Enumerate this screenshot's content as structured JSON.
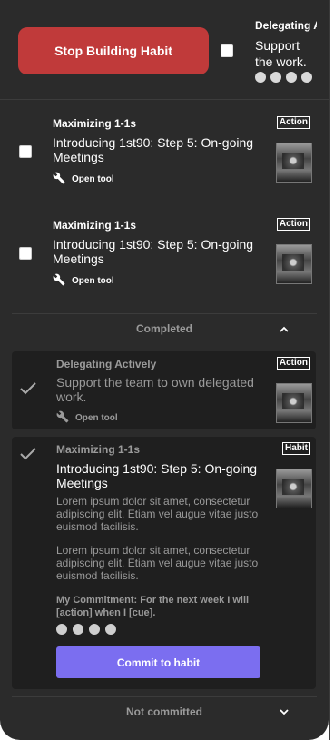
{
  "top": {
    "stop_button": "Stop Building Habit",
    "peek_habit": "Delegating Ac",
    "peek_desc": "Support the work."
  },
  "tasks": [
    {
      "habit": "Maximizing 1-1s",
      "badge": "Action",
      "title": "Introducing 1st90: Step 5: On-going Meetings",
      "tool": "Open tool"
    },
    {
      "habit": "Maximizing 1-1s",
      "badge": "Action",
      "title": "Introducing 1st90: Step 5: On-going Meetings",
      "tool": "Open tool"
    }
  ],
  "completed": {
    "label": "Completed",
    "card1": {
      "habit": "Delegating Actively",
      "badge": "Action",
      "title": "Support the team to own delegated work.",
      "tool": "Open tool"
    },
    "card2": {
      "habit": "Maximizing 1-1s",
      "badge": "Habit",
      "title": "Introducing 1st90: Step 5: On-going Meetings",
      "para1": "Lorem ipsum dolor sit amet, consectetur adipiscing elit. Etiam vel augue vitae justo euismod facilisis.",
      "para2": "Lorem ipsum dolor sit amet, consectetur adipiscing elit. Etiam vel augue vitae justo euismod facilisis.",
      "commitment": "My Commitment: For the next week I will [action] when I [cue].",
      "button": "Commit to habit"
    }
  },
  "not_committed": {
    "label": "Not committed"
  }
}
